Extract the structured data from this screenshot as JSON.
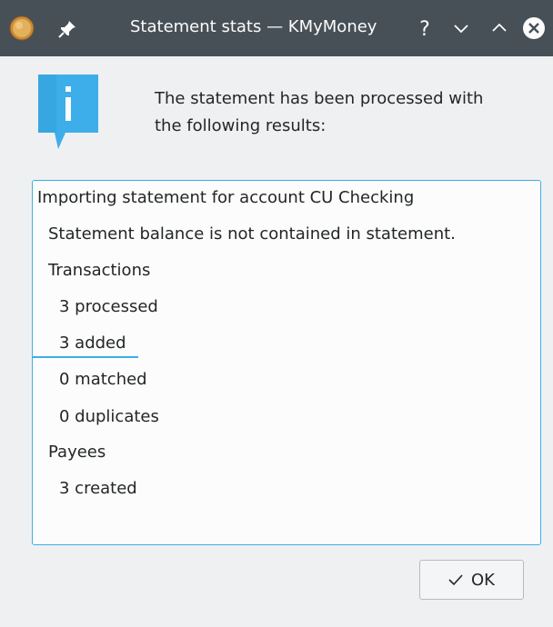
{
  "window": {
    "title": "Statement stats — KMyMoney",
    "titlebar_color": "#475057",
    "background_color": "#eff0f1",
    "app_icon": "kmymoney-coin-icon",
    "pin_icon": "pin-icon",
    "controls": {
      "help": "?",
      "minimize": "chevron-down-icon",
      "maximize": "chevron-up-icon",
      "close": "close-icon"
    }
  },
  "dialog": {
    "icon": "info-icon",
    "icon_color": "#3daee9",
    "message_line1": "The statement has been processed with",
    "message_line2": "the following results:",
    "results": [
      "Importing statement for account CU Checking",
      "Statement balance is not contained in statement.",
      "Transactions",
      "3 processed",
      "3 added",
      "0 matched",
      "0 duplicates",
      "Payees",
      "3 created"
    ],
    "accent_color": "#3daee9",
    "ok_label": "OK"
  }
}
